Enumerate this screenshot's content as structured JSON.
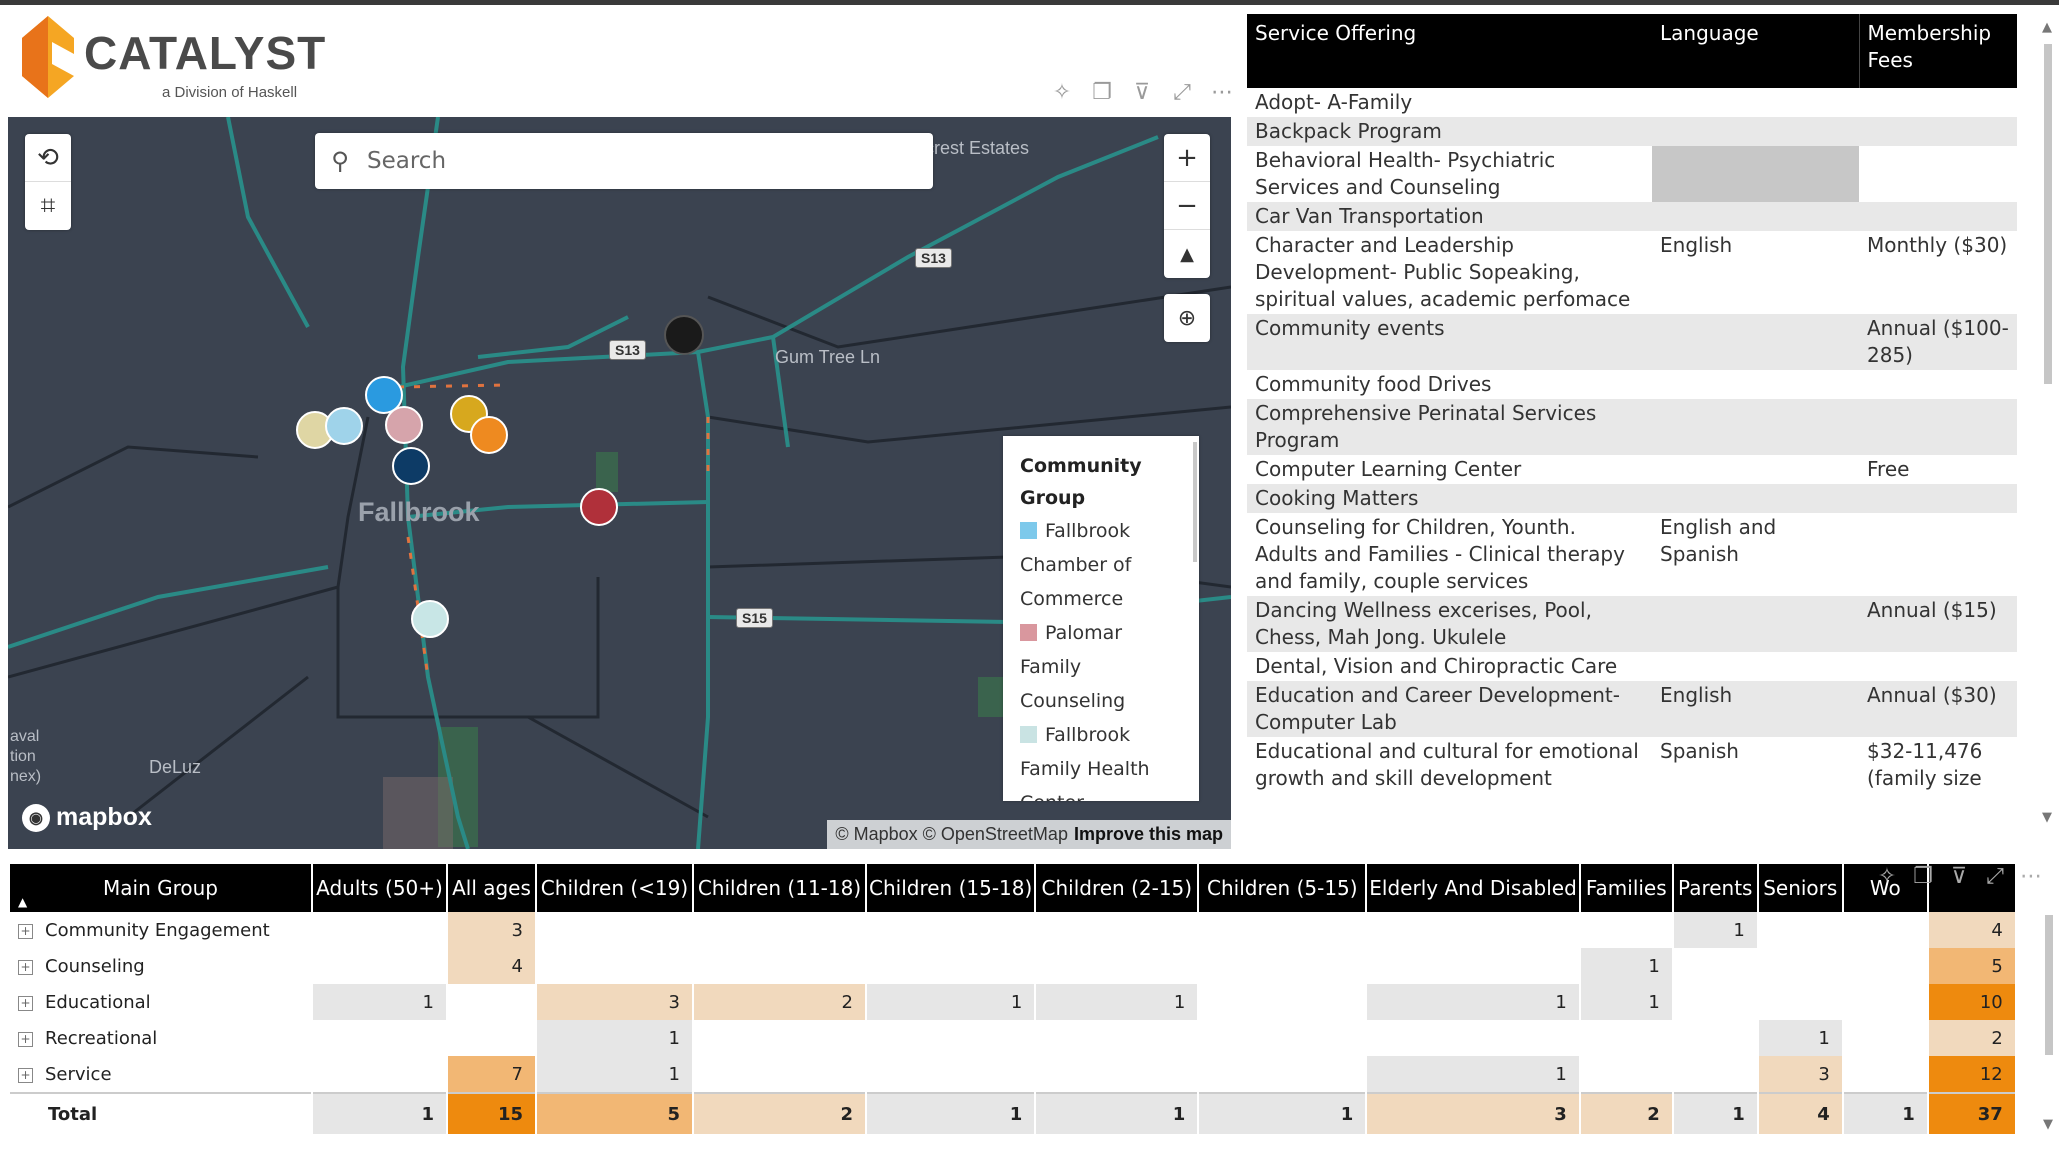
{
  "logo": {
    "text": "CATALYST",
    "subtitle": "a Division of Haskell"
  },
  "map": {
    "search_placeholder": "Search",
    "controls": {
      "zoom_in": "+",
      "zoom_out": "−"
    },
    "labels": {
      "town": "Fallbrook",
      "road": "Gum Tree Ln",
      "area": "crest Estates",
      "deluz": "DeLuz",
      "naval": [
        "aval",
        "tion",
        "nex)"
      ]
    },
    "shields": [
      "S13",
      "S13",
      "S15"
    ],
    "brand": "mapbox",
    "attribution": "© Mapbox © OpenStreetMap",
    "improve_link": "Improve this map",
    "legend": {
      "title": "Community Group",
      "items": [
        {
          "label": "Fallbrook Chamber of Commerce",
          "color": "#7dc9eb"
        },
        {
          "label": "Palomar Family Counseling",
          "color": "#d9979e"
        },
        {
          "label": "Fallbrook Family Health Center",
          "color": "#c9e3e3"
        }
      ]
    }
  },
  "services": {
    "headers": [
      "Service Offering",
      "Language",
      "Membership Fees"
    ],
    "rows": [
      {
        "service": "Adopt- A-Family",
        "language": "",
        "fees": ""
      },
      {
        "service": "Backpack Program",
        "language": "",
        "fees": ""
      },
      {
        "service": "Behavioral Health- Psychiatric Services and Counseling",
        "language": "",
        "fees": ""
      },
      {
        "service": "Car Van Transportation",
        "language": "",
        "fees": ""
      },
      {
        "service": "Character and Leadership Development- Public Sopeaking, spiritual values, academic perfomace",
        "language": "English",
        "fees": "Monthly ($30)"
      },
      {
        "service": "Community events",
        "language": "",
        "fees": "Annual ($100-285)"
      },
      {
        "service": "Community food Drives",
        "language": "",
        "fees": ""
      },
      {
        "service": "Comprehensive Perinatal Services Program",
        "language": "",
        "fees": ""
      },
      {
        "service": "Computer Learning Center",
        "language": "",
        "fees": "Free"
      },
      {
        "service": "Cooking Matters",
        "language": "",
        "fees": ""
      },
      {
        "service": "Counseling for Children, Younth. Adults and Families - Clinical therapy and family, couple services",
        "language": "English and Spanish",
        "fees": ""
      },
      {
        "service": "Dancing Wellness excerises, Pool, Chess, Mah Jong. Ukulele",
        "language": "",
        "fees": "Annual ($15)"
      },
      {
        "service": "Dental, Vision and Chiropractic Care",
        "language": "",
        "fees": ""
      },
      {
        "service": "Education and Career Development- Computer Lab",
        "language": "English",
        "fees": "Annual ($30)"
      },
      {
        "service": "Educational and cultural for emotional growth and skill development",
        "language": "Spanish",
        "fees": "$32-11,476 (family size"
      }
    ]
  },
  "matrix": {
    "row_header": "Main Group",
    "columns": [
      "Adults (50+)",
      "All ages",
      "Children (<19)",
      "Children (11-18)",
      "Children (15-18)",
      "Children (2-15)",
      "Children (5-15)",
      "Elderly And Disabled",
      "Families",
      "Parents",
      "Seniors",
      "Wo",
      ""
    ],
    "rows": [
      {
        "label": "Community Engagement",
        "expand": "+",
        "cells": [
          "",
          "3",
          "",
          "",
          "",
          "",
          "",
          "",
          "",
          "1",
          "",
          "",
          "4"
        ]
      },
      {
        "label": "Counseling",
        "expand": "+",
        "cells": [
          "",
          "4",
          "",
          "",
          "",
          "",
          "",
          "",
          "1",
          "",
          "",
          "",
          "5"
        ]
      },
      {
        "label": "Educational",
        "expand": "+",
        "cells": [
          "1",
          "",
          "3",
          "2",
          "1",
          "1",
          "",
          "1",
          "1",
          "",
          "",
          "",
          "10"
        ]
      },
      {
        "label": "Recreational",
        "expand": "+",
        "cells": [
          "",
          "",
          "1",
          "",
          "",
          "",
          "",
          "",
          "",
          "",
          "1",
          "",
          "2"
        ]
      },
      {
        "label": "Service",
        "expand": "+",
        "cells": [
          "",
          "7",
          "1",
          "",
          "",
          "",
          "",
          "1",
          "",
          "",
          "3",
          "",
          "12"
        ]
      }
    ],
    "total": {
      "label": "Total",
      "cells": [
        "1",
        "15",
        "5",
        "2",
        "1",
        "1",
        "1",
        "3",
        "2",
        "1",
        "4",
        "1",
        "37"
      ]
    }
  }
}
